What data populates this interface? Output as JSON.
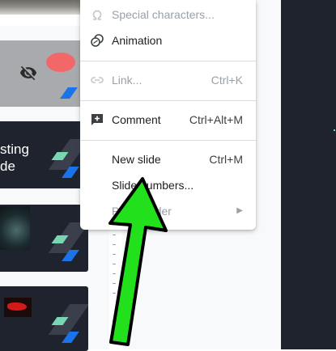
{
  "filmstrip": {
    "slide3_title": "sting\nde"
  },
  "menu": {
    "items": [
      {
        "label": "Special characters...",
        "shortcut": "",
        "disabled": true,
        "icon": "omega-icon"
      },
      {
        "label": "Animation",
        "shortcut": "",
        "disabled": false,
        "icon": "animation-icon"
      },
      {
        "label": "Link...",
        "shortcut": "Ctrl+K",
        "disabled": true,
        "icon": "link-icon"
      },
      {
        "label": "Comment",
        "shortcut": "Ctrl+Alt+M",
        "disabled": false,
        "icon": "add-comment-icon"
      },
      {
        "label": "New slide",
        "shortcut": "Ctrl+M",
        "disabled": false,
        "icon": ""
      },
      {
        "label": "Slide numbers...",
        "shortcut": "",
        "disabled": false,
        "icon": ""
      },
      {
        "label": "Placeholder",
        "shortcut": "",
        "disabled": true,
        "icon": "",
        "submenu": true
      }
    ]
  },
  "colors": {
    "arrow_fill": "#22e01b",
    "arrow_stroke": "#000000",
    "slide_dark": "#1f232d",
    "accent_teal": "#78d6b3",
    "accent_blue": "#1a73e8"
  }
}
